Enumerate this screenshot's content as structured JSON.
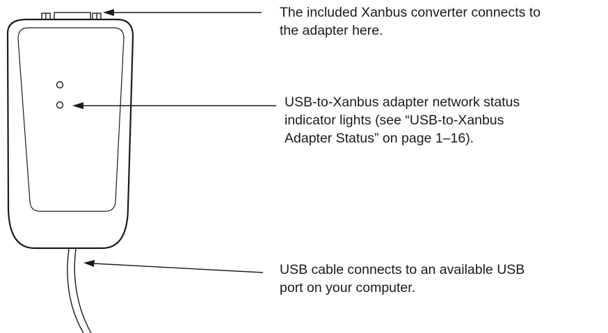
{
  "callouts": {
    "converter_port": {
      "lines": [
        "The included Xanbus converter connects to",
        "the adapter here."
      ]
    },
    "status_lights": {
      "lines": [
        "USB-to-Xanbus adapter network status",
        "indicator lights (see “USB-to-Xanbus",
        "Adapter Status” on page 1–16)."
      ]
    },
    "usb_cable": {
      "lines": [
        "USB cable connects to an available USB",
        "port on your computer."
      ]
    }
  },
  "colors": {
    "stroke": "#1a1a1a",
    "background": "#ffffff"
  }
}
